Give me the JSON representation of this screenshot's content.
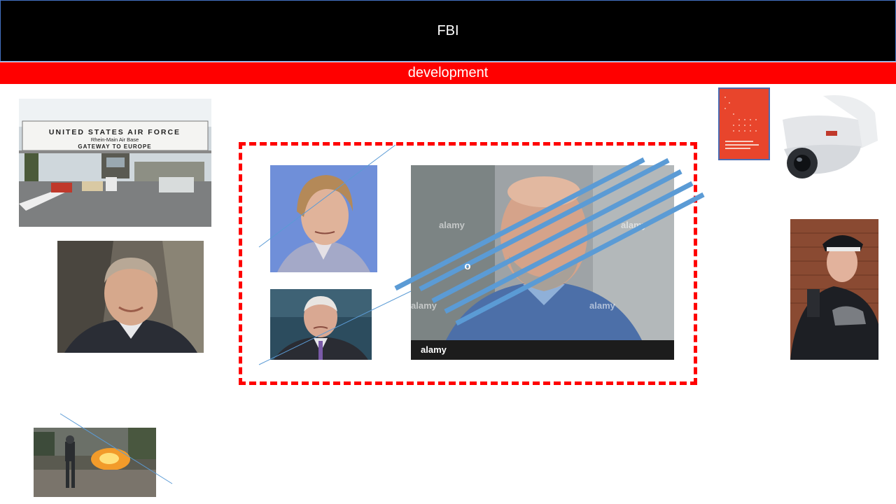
{
  "slide": {
    "title": "FBI",
    "subtitle": "development"
  },
  "images": {
    "airbase_sign_line1": "UNITED STATES AIR FORCE",
    "airbase_sign_line2": "Rhein-Main Air Base",
    "airbase_sign_line3": "GATEWAY TO EUROPE",
    "watermark": "alamy",
    "marker_letter": "o"
  },
  "colors": {
    "title_bg": "#000000",
    "subtitle_bg": "#ff0000",
    "frame": "#ff0000",
    "stripe": "#5b9bd5"
  }
}
